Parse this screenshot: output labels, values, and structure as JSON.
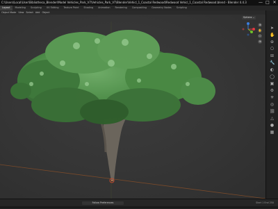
{
  "window": {
    "title": "C:\\Users\\Local\\User\\Bibliotheca_Blender\\Model Vehicles_Park_V7\\Vehicles_Park_V7\\Blender\\Vehicl_1_Coastal Redwood\\Redwood Vehicl_1_Coastal Redwood.blend - Blender 4.4.3",
    "controls": [
      "—",
      "□",
      "✕"
    ]
  },
  "workspace_tabs": [
    {
      "label": "Layout",
      "active": true
    },
    {
      "label": "Modeling",
      "active": false
    },
    {
      "label": "Sculpting",
      "active": false
    },
    {
      "label": "UV Editing",
      "active": false
    },
    {
      "label": "Texture Paint",
      "active": false
    },
    {
      "label": "Shading",
      "active": false
    },
    {
      "label": "Animation",
      "active": false
    },
    {
      "label": "Rendering",
      "active": false
    },
    {
      "label": "Compositing",
      "active": false
    },
    {
      "label": "Geometry Nodes",
      "active": false
    },
    {
      "label": "Scripting",
      "active": false
    }
  ],
  "viewport_header": {
    "mode": "Object Mode",
    "view": "View",
    "select": "Select",
    "add": "Add",
    "object": "Object"
  },
  "viewport": {
    "options_label": "Options ⌄",
    "gizmo_colors": {
      "x": "#e0393e",
      "y": "#6fbf2a",
      "z": "#3b7ddd"
    },
    "colors": {
      "foliage_dark": "#2d5a2c",
      "foliage_mid": "#4f8f4a",
      "foliage_light": "#8fc58a",
      "trunk": "#6b655c",
      "x_axis": "#7a4a2a",
      "y_axis": "#586b2a"
    }
  },
  "sidebar_icons": [
    "pointer-icon",
    "hand-icon",
    "zoom-icon",
    "camera-icon",
    "grid-icon",
    "wrench-icon",
    "scene-icon",
    "world-icon",
    "object-icon",
    "modifier-icon",
    "particles-icon",
    "physics-icon",
    "constraints-icon",
    "data-icon",
    "material-icon",
    "texture-icon"
  ],
  "timeline": {
    "playback_label": "Follow Preferences",
    "frame_label": "Start 1  End 250"
  }
}
